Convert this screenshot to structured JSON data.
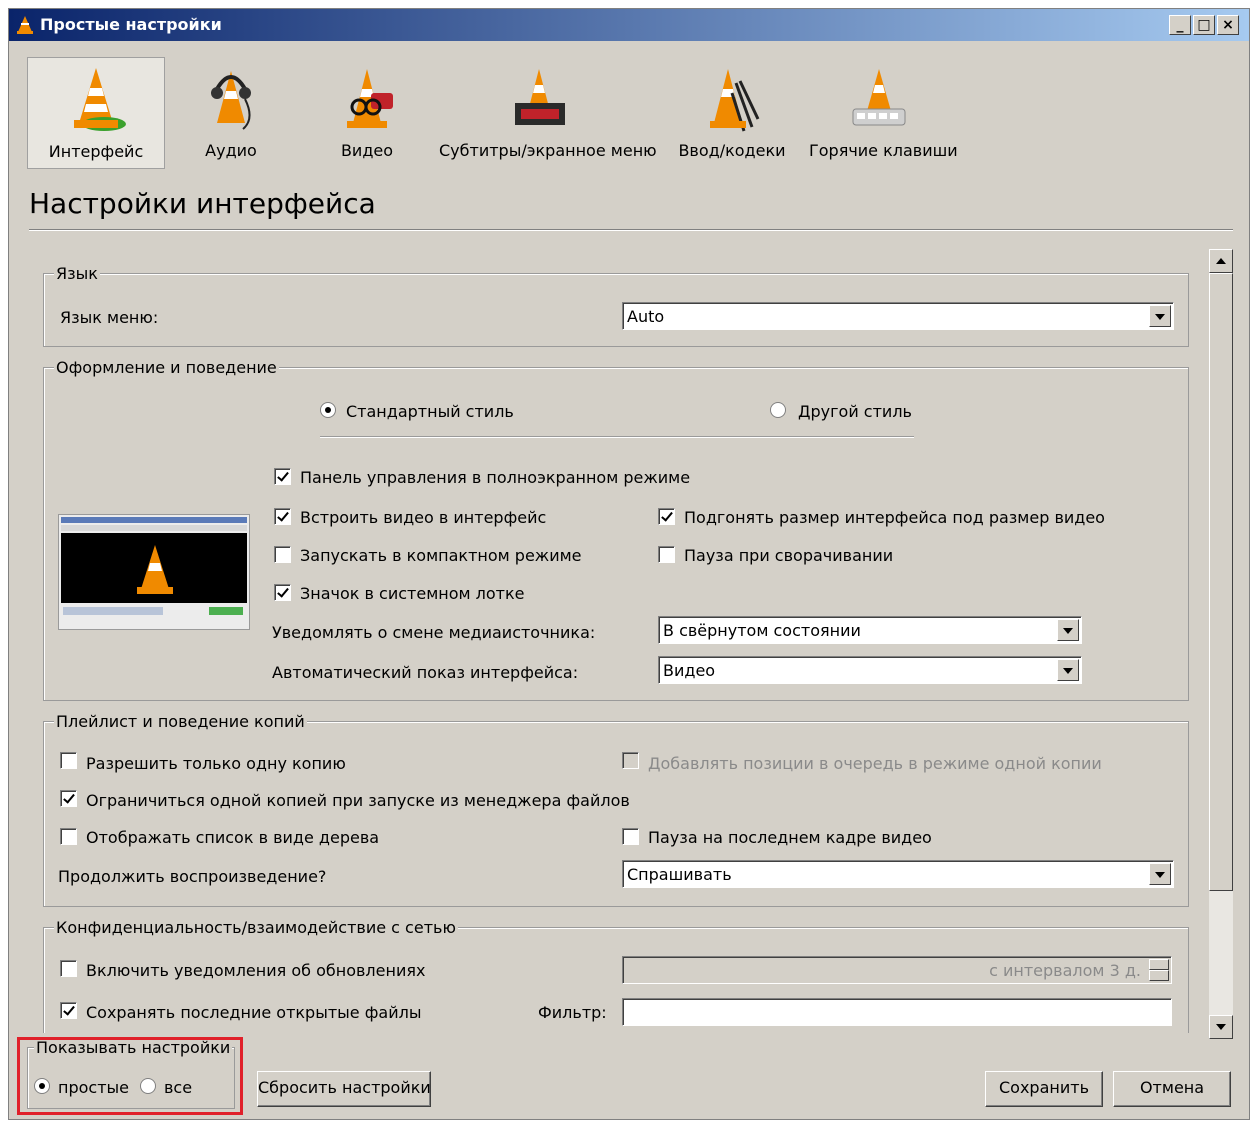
{
  "window": {
    "title": "Простые настройки",
    "min_label": "_",
    "max_label": "□",
    "close_label": "×"
  },
  "categories": [
    {
      "label": "Интерфейс",
      "icon": "interface-cone-icon",
      "active": true
    },
    {
      "label": "Аудио",
      "icon": "audio-cone-icon",
      "active": false
    },
    {
      "label": "Видео",
      "icon": "video-cone-icon",
      "active": false
    },
    {
      "label": "Субтитры/экранное меню",
      "icon": "subtitles-cone-icon",
      "active": false
    },
    {
      "label": "Ввод/кодеки",
      "icon": "input-codecs-cone-icon",
      "active": false
    },
    {
      "label": "Горячие клавиши",
      "icon": "hotkeys-cone-icon",
      "active": false
    }
  ],
  "page_title": "Настройки интерфейса",
  "language": {
    "group_label": "Язык",
    "menu_language_label": "Язык меню:",
    "menu_language_value": "Auto"
  },
  "look": {
    "group_label": "Оформление и поведение",
    "style_native_label": "Стандартный стиль",
    "style_native_selected": true,
    "style_other_label": "Другой стиль",
    "style_other_selected": false,
    "fs_controller_label": "Панель управления в полноэкранном режиме",
    "fs_controller_checked": true,
    "embed_video_label": "Встроить видео в интерфейс",
    "embed_video_checked": true,
    "resize_label": "Подгонять размер интерфейса под размер видео",
    "resize_checked": true,
    "minimal_label": "Запускать в компактном режиме",
    "minimal_checked": false,
    "pause_minimized_label": "Пауза при сворачивании",
    "pause_minimized_checked": false,
    "systray_label": "Значок в системном лотке",
    "systray_checked": true,
    "notify_label": "Уведомлять о смене медиаисточника:",
    "notify_value": "В свёрнутом состоянии",
    "raise_label": "Автоматический показ интерфейса:",
    "raise_value": "Видео"
  },
  "playlist": {
    "group_label": "Плейлист и поведение копий",
    "one_instance_label": "Разрешить только одну копию",
    "one_instance_checked": false,
    "enqueue_label": "Добавлять позиции в очередь в режиме одной копии",
    "enqueue_checked": false,
    "fm_one_instance_label": "Ограничиться одной копией при запуске из менеджера файлов",
    "fm_one_instance_checked": true,
    "tree_label": "Отображать список в виде дерева",
    "tree_checked": false,
    "pause_last_label": "Пауза на последнем кадре видео",
    "pause_last_checked": false,
    "continue_label": "Продолжить воспроизведение?",
    "continue_value": "Спрашивать"
  },
  "privacy": {
    "group_label": "Конфиденциальность/взаимодействие с сетью",
    "updates_label": "Включить уведомления об обновлениях",
    "updates_checked": false,
    "updates_interval_value": "с интервалом 3 д.",
    "recent_label": "Сохранять последние открытые файлы",
    "recent_checked": true,
    "filter_label": "Фильтр:",
    "filter_value": ""
  },
  "show_settings": {
    "group_label": "Показывать настройки",
    "simple_label": "простые",
    "simple_selected": true,
    "all_label": "все",
    "all_selected": false
  },
  "buttons": {
    "reset_label": "Сбросить настройки",
    "save_label": "Сохранить",
    "cancel_label": "Отмена"
  },
  "colors": {
    "dialog_bg": "#d4d0c8",
    "title_gradient_start": "#0a246a",
    "title_gradient_end": "#a6caf0",
    "highlight_border": "#e0202a",
    "cone_orange": "#f08a00"
  }
}
